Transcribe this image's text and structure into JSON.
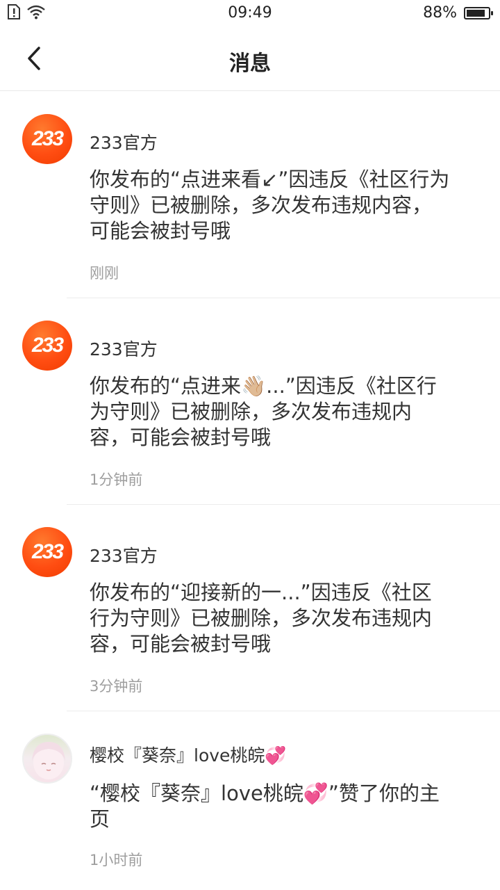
{
  "status_bar": {
    "time": "09:49",
    "battery": "88%",
    "battery_level": 0.88,
    "icons": [
      "sim-alert-icon",
      "wifi-icon"
    ]
  },
  "header": {
    "title": "消息",
    "back_icon": "chevron-left-icon"
  },
  "messages": [
    {
      "avatar_text": "233",
      "sender": "233官方",
      "text": "你发布的“点进来看↙”因违反《社区行为守则》已被删除，多次发布违规内容，可能会被封号哦",
      "time": "刚刚"
    },
    {
      "avatar_text": "233",
      "sender": "233官方",
      "text": "你发布的“点进来👋🏼...”因违反《社区行为守则》已被删除，多次发布违规内容，可能会被封号哦",
      "time": "1分钟前"
    },
    {
      "avatar_text": "233",
      "sender": "233官方",
      "text": "你发布的“迎接新的一...”因违反《社区行为守则》已被删除，多次发布违规内容，可能会被封号哦",
      "time": "3分钟前"
    },
    {
      "sender": "樱校『葵奈』love桃皖💞",
      "text": "“樱校『葵奈』love桃皖💞”赞了你的主页",
      "time": "1小时前"
    }
  ]
}
